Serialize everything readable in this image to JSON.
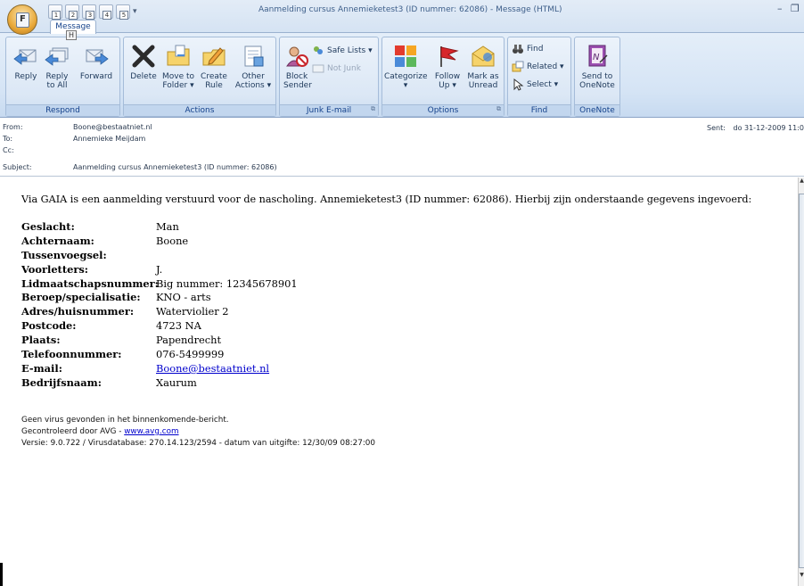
{
  "window": {
    "title": "Aanmelding cursus Annemieketest3 (ID nummer: 62086) - Message (HTML)",
    "office_button_keytip": "F",
    "qat_keytips": [
      "1",
      "2",
      "3",
      "4",
      "5"
    ],
    "minimize": "–",
    "restore": "❐"
  },
  "ribbon": {
    "tab_label": "Message",
    "tab_keytip": "H",
    "groups": {
      "respond": {
        "label": "Respond",
        "reply": "Reply",
        "reply_all_1": "Reply",
        "reply_all_2": "to All",
        "forward": "Forward"
      },
      "actions": {
        "label": "Actions",
        "delete": "Delete",
        "move_1": "Move to",
        "move_2": "Folder ▾",
        "create_1": "Create",
        "create_2": "Rule",
        "other_1": "Other",
        "other_2": "Actions ▾"
      },
      "junk": {
        "label": "Junk E-mail",
        "block_1": "Block",
        "block_2": "Sender",
        "safe_lists": "Safe Lists ▾",
        "not_junk": "Not Junk"
      },
      "options": {
        "label": "Options",
        "categorize": "Categorize",
        "categorize_2": "▾",
        "follow_1": "Follow",
        "follow_2": "Up ▾",
        "mark_1": "Mark as",
        "mark_2": "Unread"
      },
      "find": {
        "label": "Find",
        "find": "Find",
        "related": "Related ▾",
        "select": "Select ▾"
      },
      "onenote": {
        "label": "OneNote",
        "send_1": "Send to",
        "send_2": "OneNote"
      }
    }
  },
  "header": {
    "from_label": "From:",
    "from_value": "Boone@bestaatniet.nl",
    "to_label": "To:",
    "to_value": "Annemieke Meijdam",
    "cc_label": "Cc:",
    "cc_value": "",
    "subject_label": "Subject:",
    "subject_value": "Aanmelding cursus Annemieketest3 (ID nummer: 62086)",
    "sent_label": "Sent:",
    "sent_value": "do 31-12-2009 11:0"
  },
  "body": {
    "intro": "Via GAIA is een aanmelding verstuurd voor de nascholing. Annemieketest3 (ID nummer: 62086). Hierbij zijn onderstaande gegevens ingevoerd:",
    "fields": [
      {
        "label": "Geslacht:",
        "value": "Man"
      },
      {
        "label": "Achternaam:",
        "value": "Boone"
      },
      {
        "label": "Tussenvoegsel:",
        "value": ""
      },
      {
        "label": "Voorletters:",
        "value": "J."
      },
      {
        "label": "Lidmaatschapsnummer:",
        "value": "Big nummer: 12345678901"
      },
      {
        "label": "Beroep/specialisatie:",
        "value": "KNO - arts"
      },
      {
        "label": "Adres/huisnummer:",
        "value": "Waterviolier 2"
      },
      {
        "label": "Postcode:",
        "value": "4723 NA"
      },
      {
        "label": "Plaats:",
        "value": "Papendrecht"
      },
      {
        "label": "Telefoonnummer:",
        "value": "076-5499999"
      },
      {
        "label": "E-mail:",
        "value": "Boone@bestaatniet.nl"
      },
      {
        "label": "Bedrijfsnaam:",
        "value": "Xaurum"
      }
    ],
    "avg_line1": "Geen virus gevonden in het binnenkomende-bericht.",
    "avg_line2_prefix": "Gecontroleerd door AVG - ",
    "avg_link": "www.avg.com",
    "avg_line3": "Versie: 9.0.722 / Virusdatabase: 270.14.123/2594 - datum van uitgifte: 12/30/09 08:27:00"
  }
}
